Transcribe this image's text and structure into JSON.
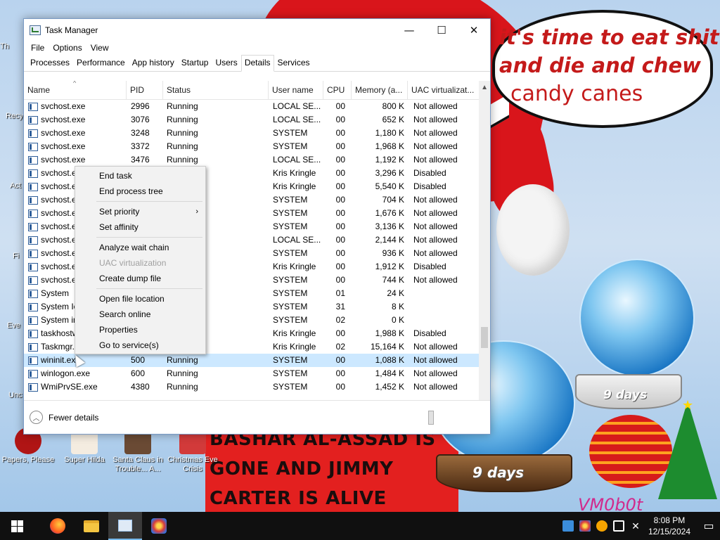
{
  "wallpaper": {
    "speech_lines": [
      "it's time to eat shit",
      "and die and chew",
      "candy canes"
    ],
    "banner_lines": [
      "BASHAR AL-ASSAD IS",
      "GONE AND JIMMY",
      "CARTER IS ALIVE"
    ],
    "globe_labels": [
      "9 days",
      "9 days"
    ],
    "watermark": "VM0b0t",
    "colors": {
      "speech_text": "#c41a1a",
      "banner": "#e3201f",
      "hat": "#d9151b"
    }
  },
  "desktop": {
    "icons": [
      {
        "label": "Papers, Please"
      },
      {
        "label": "Super Hilda"
      },
      {
        "label": "Santa Claus in Trouble... A..."
      },
      {
        "label": "Christmas Eve Crisis"
      }
    ],
    "partial_labels": [
      "Th",
      "Recy",
      "Act",
      "Fi",
      "Eve",
      "Unc"
    ]
  },
  "window": {
    "title": "Task Manager",
    "caption": {
      "minimize": "—",
      "maximize": "☐",
      "close": "✕"
    },
    "menu": [
      "File",
      "Options",
      "View"
    ],
    "tabs": [
      "Processes",
      "Performance",
      "App history",
      "Startup",
      "Users",
      "Details",
      "Services"
    ],
    "active_tab": "Details",
    "columns": [
      "Name",
      "PID",
      "Status",
      "User name",
      "CPU",
      "Memory (a...",
      "UAC virtualizat..."
    ],
    "rows": [
      {
        "name": "svchost.exe",
        "pid": "2996",
        "status": "Running",
        "user": "LOCAL SE...",
        "cpu": "00",
        "mem": "800 K",
        "uac": "Not allowed"
      },
      {
        "name": "svchost.exe",
        "pid": "3076",
        "status": "Running",
        "user": "LOCAL SE...",
        "cpu": "00",
        "mem": "652 K",
        "uac": "Not allowed"
      },
      {
        "name": "svchost.exe",
        "pid": "3248",
        "status": "Running",
        "user": "SYSTEM",
        "cpu": "00",
        "mem": "1,180 K",
        "uac": "Not allowed"
      },
      {
        "name": "svchost.exe",
        "pid": "3372",
        "status": "Running",
        "user": "SYSTEM",
        "cpu": "00",
        "mem": "1,968 K",
        "uac": "Not allowed"
      },
      {
        "name": "svchost.exe",
        "pid": "3476",
        "status": "Running",
        "user": "LOCAL SE...",
        "cpu": "00",
        "mem": "1,192 K",
        "uac": "Not allowed"
      },
      {
        "name": "svchost.e",
        "pid": "",
        "status": "",
        "user": "Kris Kringle",
        "cpu": "00",
        "mem": "3,296 K",
        "uac": "Disabled"
      },
      {
        "name": "svchost.e",
        "pid": "",
        "status": "",
        "user": "Kris Kringle",
        "cpu": "00",
        "mem": "5,540 K",
        "uac": "Disabled"
      },
      {
        "name": "svchost.e",
        "pid": "",
        "status": "",
        "user": "SYSTEM",
        "cpu": "00",
        "mem": "704 K",
        "uac": "Not allowed"
      },
      {
        "name": "svchost.e",
        "pid": "",
        "status": "",
        "user": "SYSTEM",
        "cpu": "00",
        "mem": "1,676 K",
        "uac": "Not allowed"
      },
      {
        "name": "svchost.e",
        "pid": "",
        "status": "",
        "user": "SYSTEM",
        "cpu": "00",
        "mem": "3,136 K",
        "uac": "Not allowed"
      },
      {
        "name": "svchost.e",
        "pid": "",
        "status": "",
        "user": "LOCAL SE...",
        "cpu": "00",
        "mem": "2,144 K",
        "uac": "Not allowed"
      },
      {
        "name": "svchost.e",
        "pid": "",
        "status": "",
        "user": "SYSTEM",
        "cpu": "00",
        "mem": "936 K",
        "uac": "Not allowed"
      },
      {
        "name": "svchost.e",
        "pid": "",
        "status": "",
        "user": "Kris Kringle",
        "cpu": "00",
        "mem": "1,912 K",
        "uac": "Disabled"
      },
      {
        "name": "svchost.e",
        "pid": "",
        "status": "",
        "user": "SYSTEM",
        "cpu": "00",
        "mem": "744 K",
        "uac": "Not allowed"
      },
      {
        "name": "System",
        "pid": "",
        "status": "",
        "user": "SYSTEM",
        "cpu": "01",
        "mem": "24 K",
        "uac": ""
      },
      {
        "name": "System Ic",
        "pid": "",
        "status": "",
        "user": "SYSTEM",
        "cpu": "31",
        "mem": "8 K",
        "uac": ""
      },
      {
        "name": "System in",
        "pid": "",
        "status": "",
        "user": "SYSTEM",
        "cpu": "02",
        "mem": "0 K",
        "uac": ""
      },
      {
        "name": "taskhostw",
        "pid": "",
        "status": "",
        "user": "Kris Kringle",
        "cpu": "00",
        "mem": "1,988 K",
        "uac": "Disabled"
      },
      {
        "name": "Taskmgr.",
        "pid": "",
        "status": "",
        "user": "Kris Kringle",
        "cpu": "02",
        "mem": "15,164 K",
        "uac": "Not allowed"
      },
      {
        "name": "wininit.ex",
        "pid": "500",
        "status": "Running",
        "user": "SYSTEM",
        "cpu": "00",
        "mem": "1,088 K",
        "uac": "Not allowed"
      },
      {
        "name": "winlogon.exe",
        "pid": "600",
        "status": "Running",
        "user": "SYSTEM",
        "cpu": "00",
        "mem": "1,484 K",
        "uac": "Not allowed"
      },
      {
        "name": "WmiPrvSE.exe",
        "pid": "4380",
        "status": "Running",
        "user": "SYSTEM",
        "cpu": "00",
        "mem": "1,452 K",
        "uac": "Not allowed"
      }
    ],
    "selected_row": 19,
    "footer": {
      "fewer_details": "Fewer details"
    }
  },
  "context_menu": {
    "groups": [
      [
        {
          "label": "End task",
          "enabled": true
        },
        {
          "label": "End process tree",
          "enabled": true
        }
      ],
      [
        {
          "label": "Set priority",
          "enabled": true,
          "submenu": true
        },
        {
          "label": "Set affinity",
          "enabled": true
        }
      ],
      [
        {
          "label": "Analyze wait chain",
          "enabled": true
        },
        {
          "label": "UAC virtualization",
          "enabled": false
        },
        {
          "label": "Create dump file",
          "enabled": true
        }
      ],
      [
        {
          "label": "Open file location",
          "enabled": true
        },
        {
          "label": "Search online",
          "enabled": true
        },
        {
          "label": "Properties",
          "enabled": true
        },
        {
          "label": "Go to service(s)",
          "enabled": true
        }
      ]
    ]
  },
  "taskbar": {
    "time": "8:08 PM",
    "date": "12/15/2024",
    "apps": [
      {
        "icon": "firefox-icon"
      },
      {
        "icon": "file-explorer-icon"
      },
      {
        "icon": "task-manager-icon",
        "active": true
      },
      {
        "icon": "game-app-icon"
      }
    ]
  }
}
